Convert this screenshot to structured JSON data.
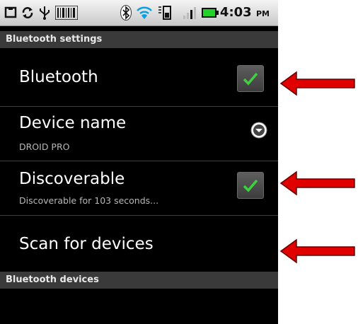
{
  "status_bar": {
    "time": "4:03",
    "ampm": "PM",
    "icons": [
      "notification-icon",
      "sync-icon",
      "usb-icon",
      "barcode-icon",
      "bluetooth-icon",
      "wifi-icon",
      "network-icon",
      "signal-icon",
      "battery-icon"
    ]
  },
  "header": {
    "title": "Bluetooth settings"
  },
  "settings": [
    {
      "title": "Bluetooth",
      "summary": "",
      "control": "checkbox",
      "checked": true
    },
    {
      "title": "Device name",
      "summary": "DROID PRO",
      "control": "dropdown"
    },
    {
      "title": "Discoverable",
      "summary": "Discoverable for 103 seconds...",
      "control": "checkbox",
      "checked": true
    },
    {
      "title": "Scan for devices",
      "summary": "",
      "control": "none"
    }
  ],
  "devices_section": {
    "title": "Bluetooth devices"
  },
  "colors": {
    "check_green": "#3fcf3f",
    "arrow_red": "#e00000",
    "header_bg": "#3a3a3a"
  }
}
